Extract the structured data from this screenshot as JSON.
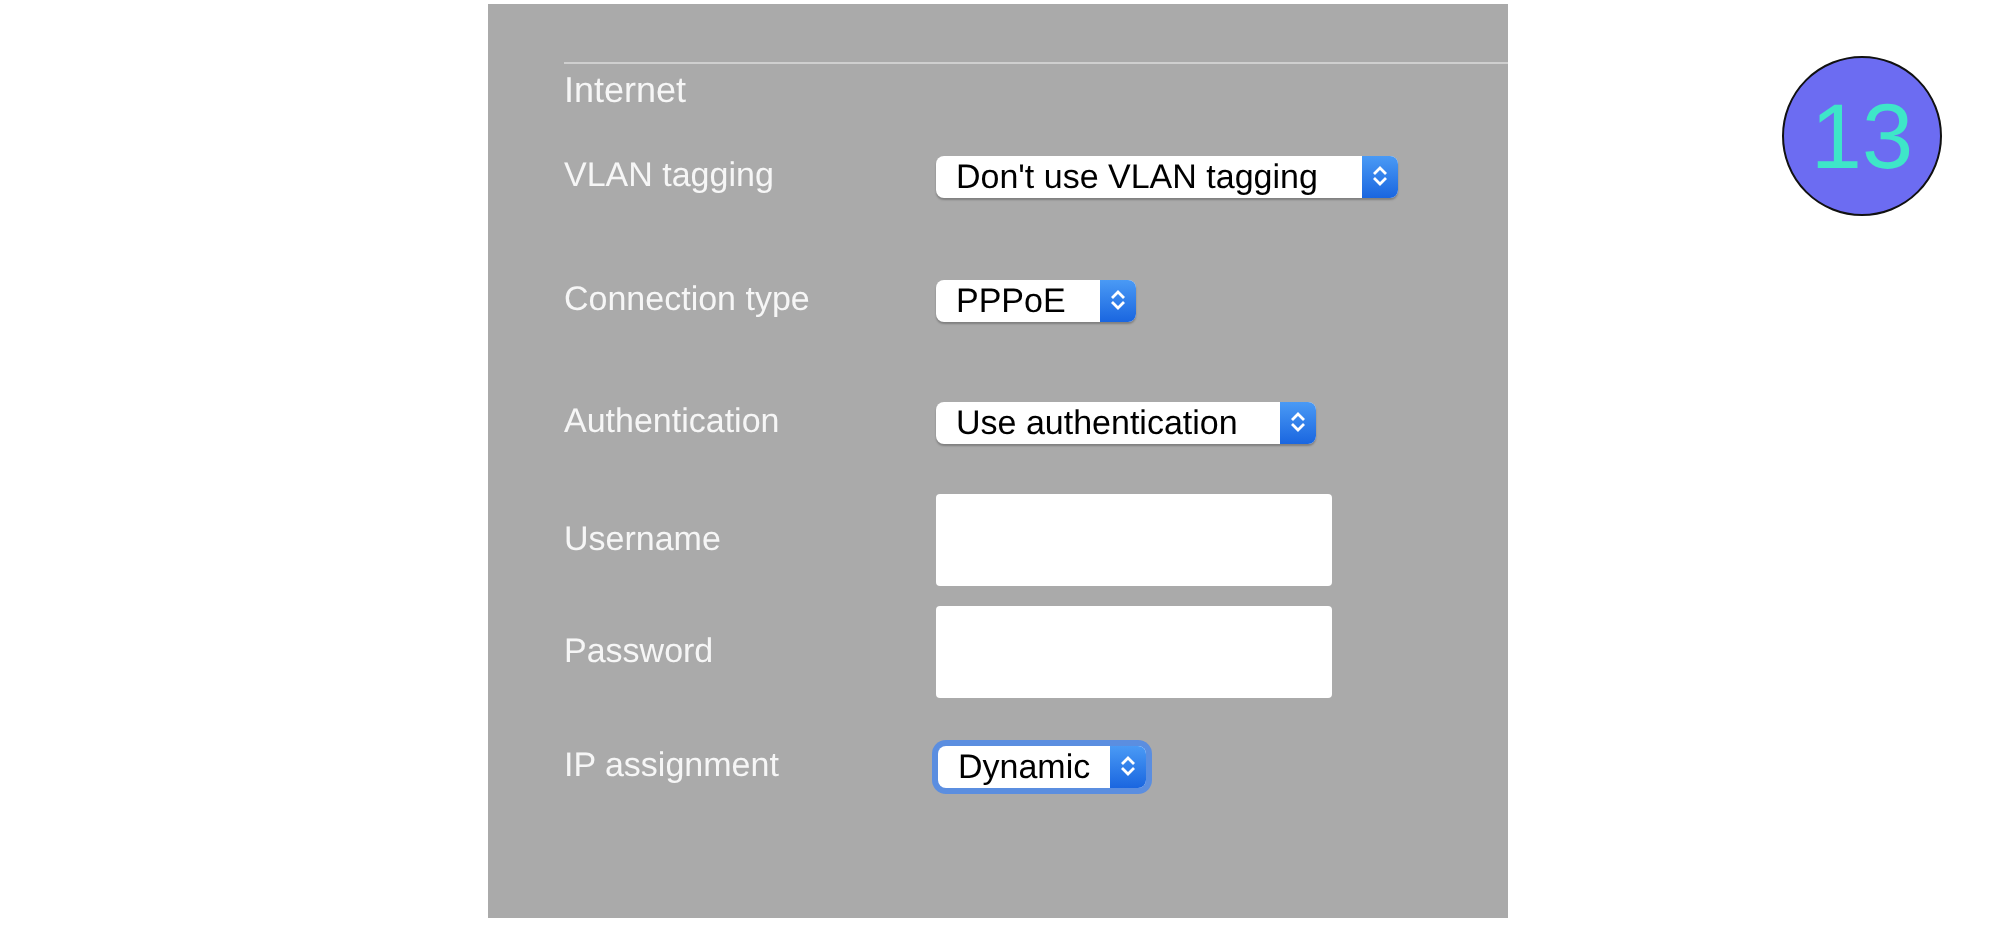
{
  "section": {
    "title": "Internet"
  },
  "fields": [
    {
      "label": "VLAN tagging",
      "kind": "select",
      "value": "Don't use VLAN tagging",
      "focused": false
    },
    {
      "label": "Connection type",
      "kind": "select",
      "value": "PPPoE",
      "focused": false
    },
    {
      "label": "Authentication",
      "kind": "select",
      "value": "Use authentication",
      "focused": false
    },
    {
      "label": "Username",
      "kind": "text",
      "focused": false
    },
    {
      "label": "Password",
      "kind": "password",
      "focused": false
    },
    {
      "label": "IP assignment",
      "kind": "select",
      "value": "Dynamic",
      "focused": true
    }
  ],
  "badge": {
    "text": "13"
  }
}
